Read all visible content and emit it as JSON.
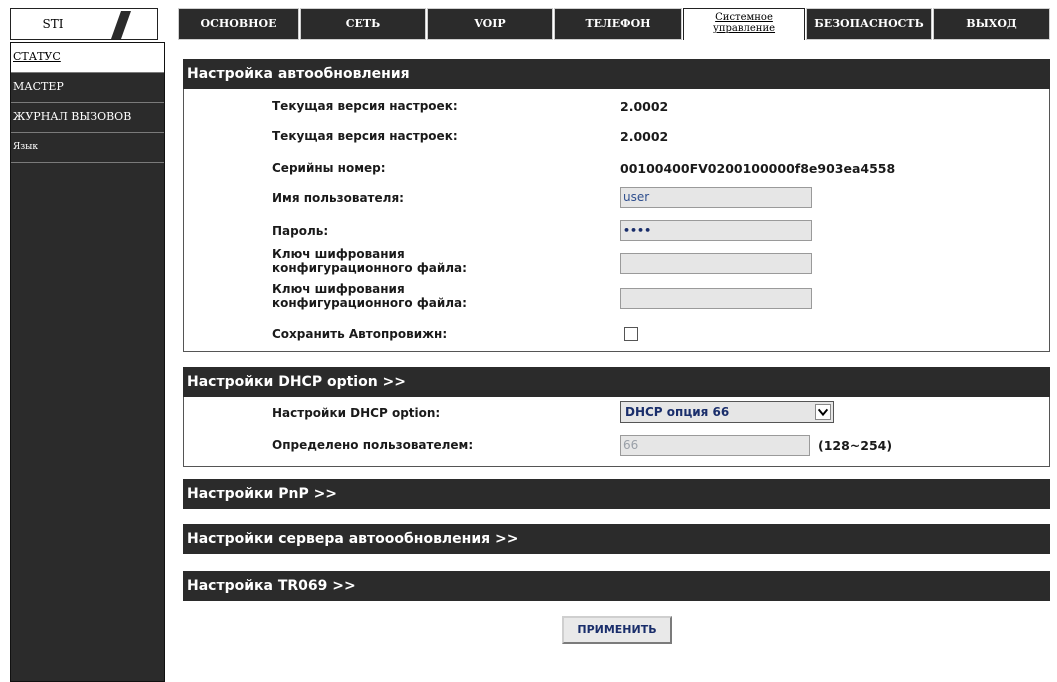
{
  "logo": {
    "text": "STI"
  },
  "nav_tabs": [
    {
      "label": "ОСНОВНОЕ"
    },
    {
      "label": "СЕТЬ"
    },
    {
      "label": "VOIP"
    },
    {
      "label": "ТЕЛЕФОН"
    },
    {
      "label": "Системное управление"
    },
    {
      "label": "БЕЗОПАСНОСТЬ"
    },
    {
      "label": "ВЫХОД"
    }
  ],
  "active_tab_index": 4,
  "sidebar": {
    "items": [
      {
        "label": "СТАТУС"
      },
      {
        "label": "МАСТЕР"
      },
      {
        "label": "ЖУРНАЛ ВЫЗОВОВ"
      },
      {
        "label": "Язык"
      }
    ]
  },
  "autoupdate": {
    "title": "Настройка автообновления",
    "rows": [
      {
        "label": "Текущая версия настроек:",
        "value": "2.0002"
      },
      {
        "label": "Текущая версия настроек:",
        "value": "2.0002"
      },
      {
        "label": "Серийны номер:",
        "value": "00100400FV0200100000f8e903ea4558"
      }
    ],
    "username": {
      "label": "Имя пользователя:",
      "value": "user"
    },
    "password": {
      "label": "Пароль:",
      "value": "••••"
    },
    "enc_key_1": {
      "label_line1": "Ключ шифрования",
      "label_line2": "конфигурационного файла:",
      "value": ""
    },
    "enc_key_2": {
      "label_line1": "Ключ шифрования",
      "label_line2": "конфигурационного файла:",
      "value": ""
    },
    "save_autoprov": {
      "label": "Сохранить Автопровижн:",
      "checked": false
    }
  },
  "dhcp": {
    "title": "Настройки DHCP option >>",
    "option": {
      "label": "Настройки DHCP option:",
      "selected": "DHCP опция 66"
    },
    "custom": {
      "label": "Определено пользователем:",
      "value": "66",
      "range": "(128~254)"
    }
  },
  "collapsed_sections": [
    {
      "title": "Настройки PnP >>"
    },
    {
      "title": "Настройки сервера автоообновления >>"
    },
    {
      "title": "Настройка TR069 >>"
    }
  ],
  "apply_button": {
    "label": "ПРИМЕНИТЬ"
  },
  "colors": {
    "dark": "#2b2b2b",
    "field_bg": "#e6e6e6",
    "input_text": "#1a2e6b"
  }
}
